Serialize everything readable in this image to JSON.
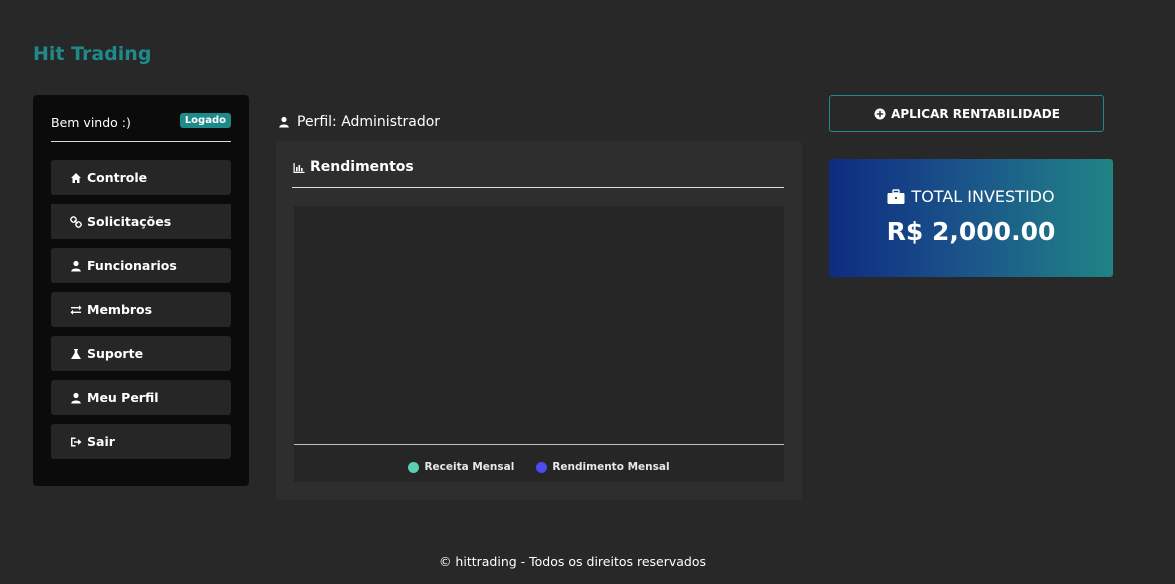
{
  "brand": "Hit Trading",
  "sidebar": {
    "welcome": "Bem vindo :)",
    "badge": "Logado",
    "items": [
      {
        "label": "Controle",
        "icon": "home-icon"
      },
      {
        "label": "Solicitações",
        "icon": "link-icon"
      },
      {
        "label": "Funcionarios",
        "icon": "user-icon"
      },
      {
        "label": "Membros",
        "icon": "exchange-icon"
      },
      {
        "label": "Suporte",
        "icon": "flask-icon"
      },
      {
        "label": "Meu Perfil",
        "icon": "user-icon"
      },
      {
        "label": "Sair",
        "icon": "sign-out-icon"
      }
    ]
  },
  "profile": {
    "label": "Perfil: Administrador"
  },
  "chart_card": {
    "title": "Rendimentos",
    "legend": [
      {
        "name": "Receita Mensal",
        "color": "#5ad0b0"
      },
      {
        "name": "Rendimento Mensal",
        "color": "#4b4bf0"
      }
    ]
  },
  "chart_data": {
    "type": "line",
    "title": "Rendimentos",
    "series": [
      {
        "name": "Receita Mensal",
        "values": []
      },
      {
        "name": "Rendimento Mensal",
        "values": []
      }
    ],
    "legend": "bottom"
  },
  "actions": {
    "apply_label": "APLICAR RENTABILIDADE"
  },
  "total": {
    "label": "TOTAL INVESTIDO",
    "value": "R$ 2,000.00"
  },
  "footer": "© hittrading - Todos os direitos reservados",
  "colors": {
    "accent": "#1f8a8a",
    "background": "#282828",
    "sidebar": "#0b0b0b"
  }
}
